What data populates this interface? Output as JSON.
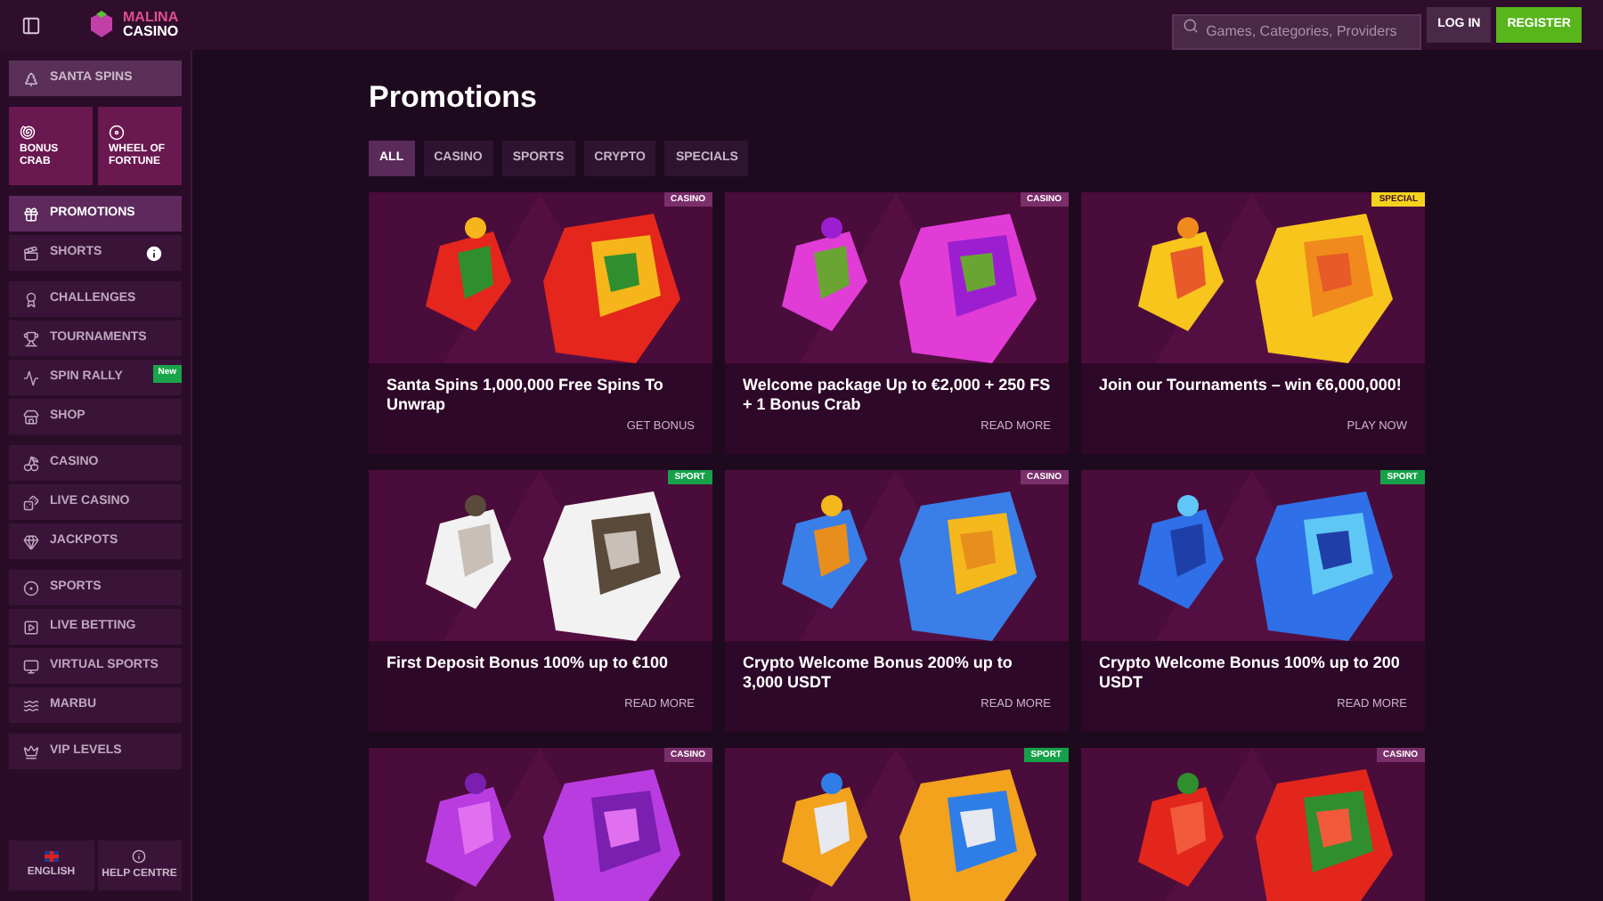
{
  "header": {
    "logo_top": "MALINA",
    "logo_bottom": "CASINO",
    "search": {
      "placeholder": "Games, Categories, Providers"
    },
    "login": "LOG IN",
    "register": "REGISTER"
  },
  "sidebar": {
    "top": {
      "label": "SANTA SPINS"
    },
    "tiles": [
      {
        "label": "BONUS CRAB"
      },
      {
        "label": "WHEEL OF FORTUNE"
      }
    ],
    "groups": [
      [
        {
          "label": "PROMOTIONS",
          "selected": true
        },
        {
          "label": "SHORTS",
          "selected": false,
          "info": true
        }
      ],
      [
        {
          "label": "CHALLENGES",
          "selected": false
        },
        {
          "label": "TOURNAMENTS",
          "selected": false
        },
        {
          "label": "SPIN RALLY",
          "selected": false,
          "badge": "New"
        },
        {
          "label": "SHOP",
          "selected": false
        }
      ],
      [
        {
          "label": "CASINO",
          "selected": false
        },
        {
          "label": "LIVE CASINO",
          "selected": false
        },
        {
          "label": "JACKPOTS",
          "selected": false
        }
      ],
      [
        {
          "label": "SPORTS",
          "selected": false
        },
        {
          "label": "LIVE BETTING",
          "selected": false
        },
        {
          "label": "VIRTUAL SPORTS",
          "selected": false
        },
        {
          "label": "MARBU",
          "selected": false
        }
      ],
      [
        {
          "label": "VIP LEVELS",
          "selected": false
        }
      ]
    ],
    "footer": [
      {
        "label": "ENGLISH",
        "kind": "language"
      },
      {
        "label": "HELP CENTRE",
        "kind": "help"
      }
    ]
  },
  "page_title": "Promotions",
  "tabs": [
    {
      "label": "ALL",
      "selected": true
    },
    {
      "label": "CASINO",
      "selected": false
    },
    {
      "label": "SPORTS",
      "selected": false
    },
    {
      "label": "CRYPTO",
      "selected": false
    },
    {
      "label": "SPECIALS",
      "selected": false
    }
  ],
  "cards": [
    {
      "tag": "CASINO",
      "kind": "casino",
      "title": "Santa Spins 1,000,000 Free Spins To Unwrap",
      "action": "GET BONUS"
    },
    {
      "tag": "CASINO",
      "kind": "casino",
      "title": "Welcome package Up to €2,000 + 250 FS + 1 Bonus Crab",
      "action": "READ MORE"
    },
    {
      "tag": "SPECIAL",
      "kind": "special",
      "title": "Join our Tournaments – win €6,000,000!",
      "action": "PLAY NOW"
    },
    {
      "tag": "SPORT",
      "kind": "sport",
      "title": "First Deposit Bonus 100% up to €100",
      "action": "READ MORE"
    },
    {
      "tag": "CASINO",
      "kind": "casino",
      "title": "Crypto Welcome Bonus 200% up to 3,000 USDT",
      "action": "READ MORE"
    },
    {
      "tag": "SPORT",
      "kind": "sport",
      "title": "Crypto Welcome Bonus 100% up to 200 USDT",
      "action": "READ MORE"
    },
    {
      "tag": "CASINO",
      "kind": "casino"
    },
    {
      "tag": "SPORT",
      "kind": "sport"
    },
    {
      "tag": "CASINO",
      "kind": "casino"
    }
  ]
}
